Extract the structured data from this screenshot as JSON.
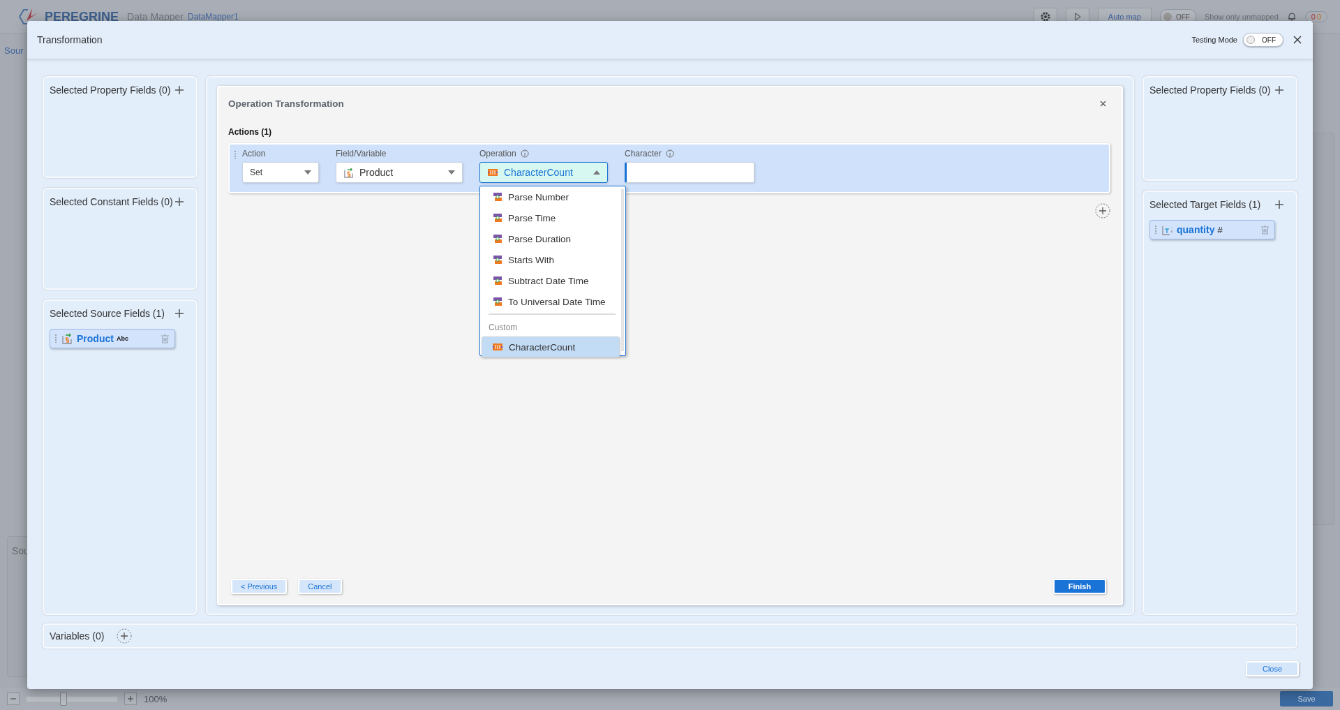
{
  "app": {
    "logo": "PEREGRINE",
    "title": "Data Mapper",
    "document": "DataMapper1",
    "auto_map": "Auto map",
    "unmapped_toggle": {
      "label": "OFF",
      "on": false
    },
    "show_unmapped": "Show only unmapped",
    "badges": [
      "0",
      "0"
    ],
    "side_tab": "Sour",
    "bottom_section": "Sou",
    "zoom": {
      "level": 0.4,
      "reading": "100%"
    },
    "save": "Save"
  },
  "dialog": {
    "title": "Transformation",
    "testing_mode": {
      "label": "Testing Mode",
      "toggle": "OFF",
      "on": false
    },
    "left_panels": [
      {
        "title": "Selected Property Fields (0)"
      },
      {
        "title": "Selected Constant Fields (0)"
      },
      {
        "title": "Selected Source Fields (1)",
        "fields": [
          {
            "name": "Product",
            "type": "Abc",
            "kind": "string"
          }
        ]
      }
    ],
    "operation": {
      "title": "Operation Transformation",
      "actions_heading": "Actions (1)",
      "action": {
        "label": "Action",
        "value": "Set"
      },
      "field": {
        "label": "Field/Variable",
        "value": "Product"
      },
      "op": {
        "label": "Operation",
        "value": "CharacterCount",
        "expanded": true
      },
      "character": {
        "label": "Character"
      },
      "dropdown_items": [
        {
          "kind": "builtin",
          "label": "Parse Number",
          "selected": false
        },
        {
          "kind": "builtin",
          "label": "Parse Time",
          "selected": false
        },
        {
          "kind": "builtin",
          "label": "Parse Duration",
          "selected": false
        },
        {
          "kind": "builtin",
          "label": "Starts With",
          "selected": false
        },
        {
          "kind": "builtin",
          "label": "Subtract Date Time",
          "selected": false
        },
        {
          "kind": "builtin",
          "label": "To Universal Date Time",
          "selected": false
        },
        {
          "kind": "group",
          "label": "Custom"
        },
        {
          "kind": "custom",
          "label": "CharacterCount",
          "selected": true
        }
      ],
      "previous": "< Previous",
      "cancel": "Cancel",
      "finish": "Finish"
    },
    "right_panels": [
      {
        "title": "Selected Property Fields (0)"
      },
      {
        "title": "Selected Target Fields (1)",
        "fields": [
          {
            "name": "quantity",
            "type": "#",
            "kind": "number"
          }
        ]
      }
    ],
    "variables": "Variables (0)",
    "close": "Close"
  }
}
